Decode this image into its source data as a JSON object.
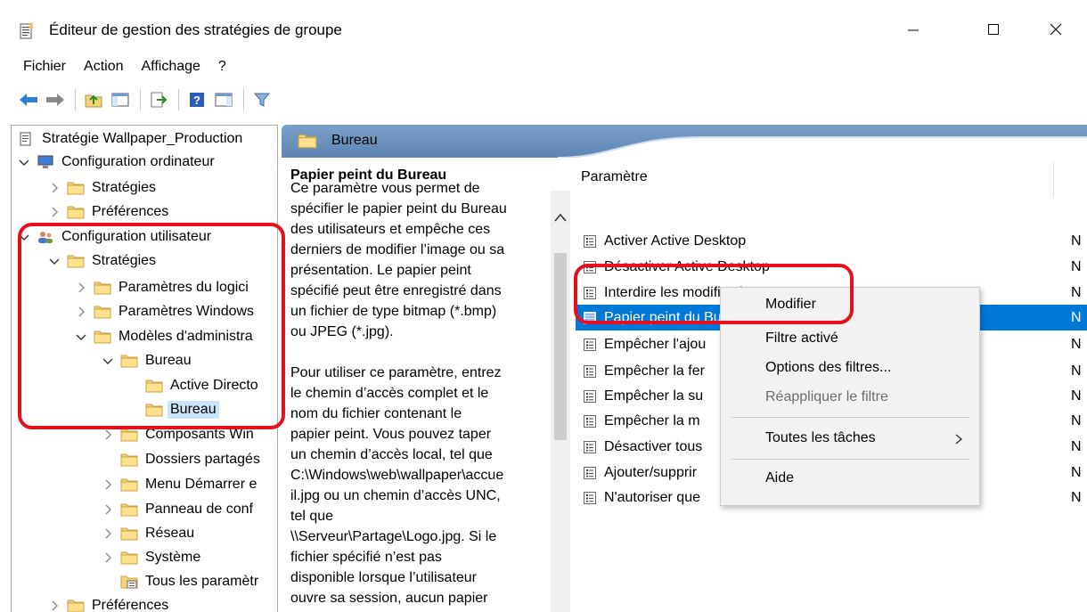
{
  "window": {
    "title": "Éditeur de gestion des stratégies de groupe"
  },
  "menu": [
    "Fichier",
    "Action",
    "Affichage",
    "?"
  ],
  "tree": {
    "items": [
      {
        "label": "Stratégie Wallpaper_Production"
      },
      {
        "label": "Configuration ordinateur"
      },
      {
        "label": "Stratégies"
      },
      {
        "label": "Préférences"
      },
      {
        "label": "Configuration utilisateur"
      },
      {
        "label": "Stratégies"
      },
      {
        "label": "Paramètres du logici"
      },
      {
        "label": "Paramètres Windows"
      },
      {
        "label": "Modèles d'administra"
      },
      {
        "label": "Bureau"
      },
      {
        "label": "Active Directo"
      },
      {
        "label": "Bureau"
      },
      {
        "label": "Composants Win"
      },
      {
        "label": "Dossiers partagés"
      },
      {
        "label": "Menu Démarrer e"
      },
      {
        "label": "Panneau de conf"
      },
      {
        "label": "Réseau"
      },
      {
        "label": "Système"
      },
      {
        "label": "Tous les paramètr"
      },
      {
        "label": "Préférences"
      }
    ]
  },
  "content": {
    "header": "Bureau",
    "description": {
      "title": "Papier peint du Bureau",
      "lines": [
        "Ce paramètre vous permet de",
        "spécifier le papier peint du Bureau",
        "des utilisateurs et empêche ces",
        "derniers de modifier l’image ou sa",
        "présentation. Le papier peint",
        "spécifié peut être enregistré dans",
        "un fichier de type bitmap (*.bmp)",
        "ou JPEG (*.jpg).",
        "",
        "Pour utiliser ce paramètre, entrez",
        "le chemin d’accès complet et le",
        "nom du fichier contenant le",
        "papier peint. Vous pouvez taper",
        "un chemin d’accès local, tel que",
        "C:\\Windows\\web\\wallpaper\\accue",
        "il.jpg ou un chemin d’accès UNC,",
        "tel que",
        "\\\\Serveur\\Partage\\Logo.jpg. Si le",
        "fichier spécifié n’est pas",
        "disponible lorsque l’utilisateur",
        "ouvre sa session, aucun papier"
      ]
    },
    "column_header": "Paramètre",
    "rows": [
      {
        "label": "Activer Active Desktop",
        "state": "N"
      },
      {
        "label": "Désactiver Active Desktop",
        "state": "N"
      },
      {
        "label": "Interdire les modifications",
        "state": "N"
      },
      {
        "label": "Papier peint du Bureau",
        "state": "N"
      },
      {
        "label": "Empêcher l'ajou",
        "state": "N"
      },
      {
        "label": "Empêcher la fer",
        "state": "N"
      },
      {
        "label": "Empêcher la su",
        "state": "N"
      },
      {
        "label": "Empêcher la m",
        "state": "N"
      },
      {
        "label": "Désactiver tous",
        "state": "N"
      },
      {
        "label": "Ajouter/supprir",
        "state": "N"
      },
      {
        "label": "N'autoriser que",
        "state": "N"
      }
    ]
  },
  "context_menu": {
    "items": [
      {
        "label": "Modifier"
      },
      {
        "label": "Filtre activé"
      },
      {
        "label": "Options des filtres..."
      },
      {
        "label": "Réappliquer le filtre"
      },
      {
        "label": "Toutes les tâches"
      },
      {
        "label": "Aide"
      }
    ]
  },
  "colors": {
    "selection": "#0078d7",
    "highlight_annotation": "#e8101e",
    "header_gradient": "#6b92bf"
  }
}
